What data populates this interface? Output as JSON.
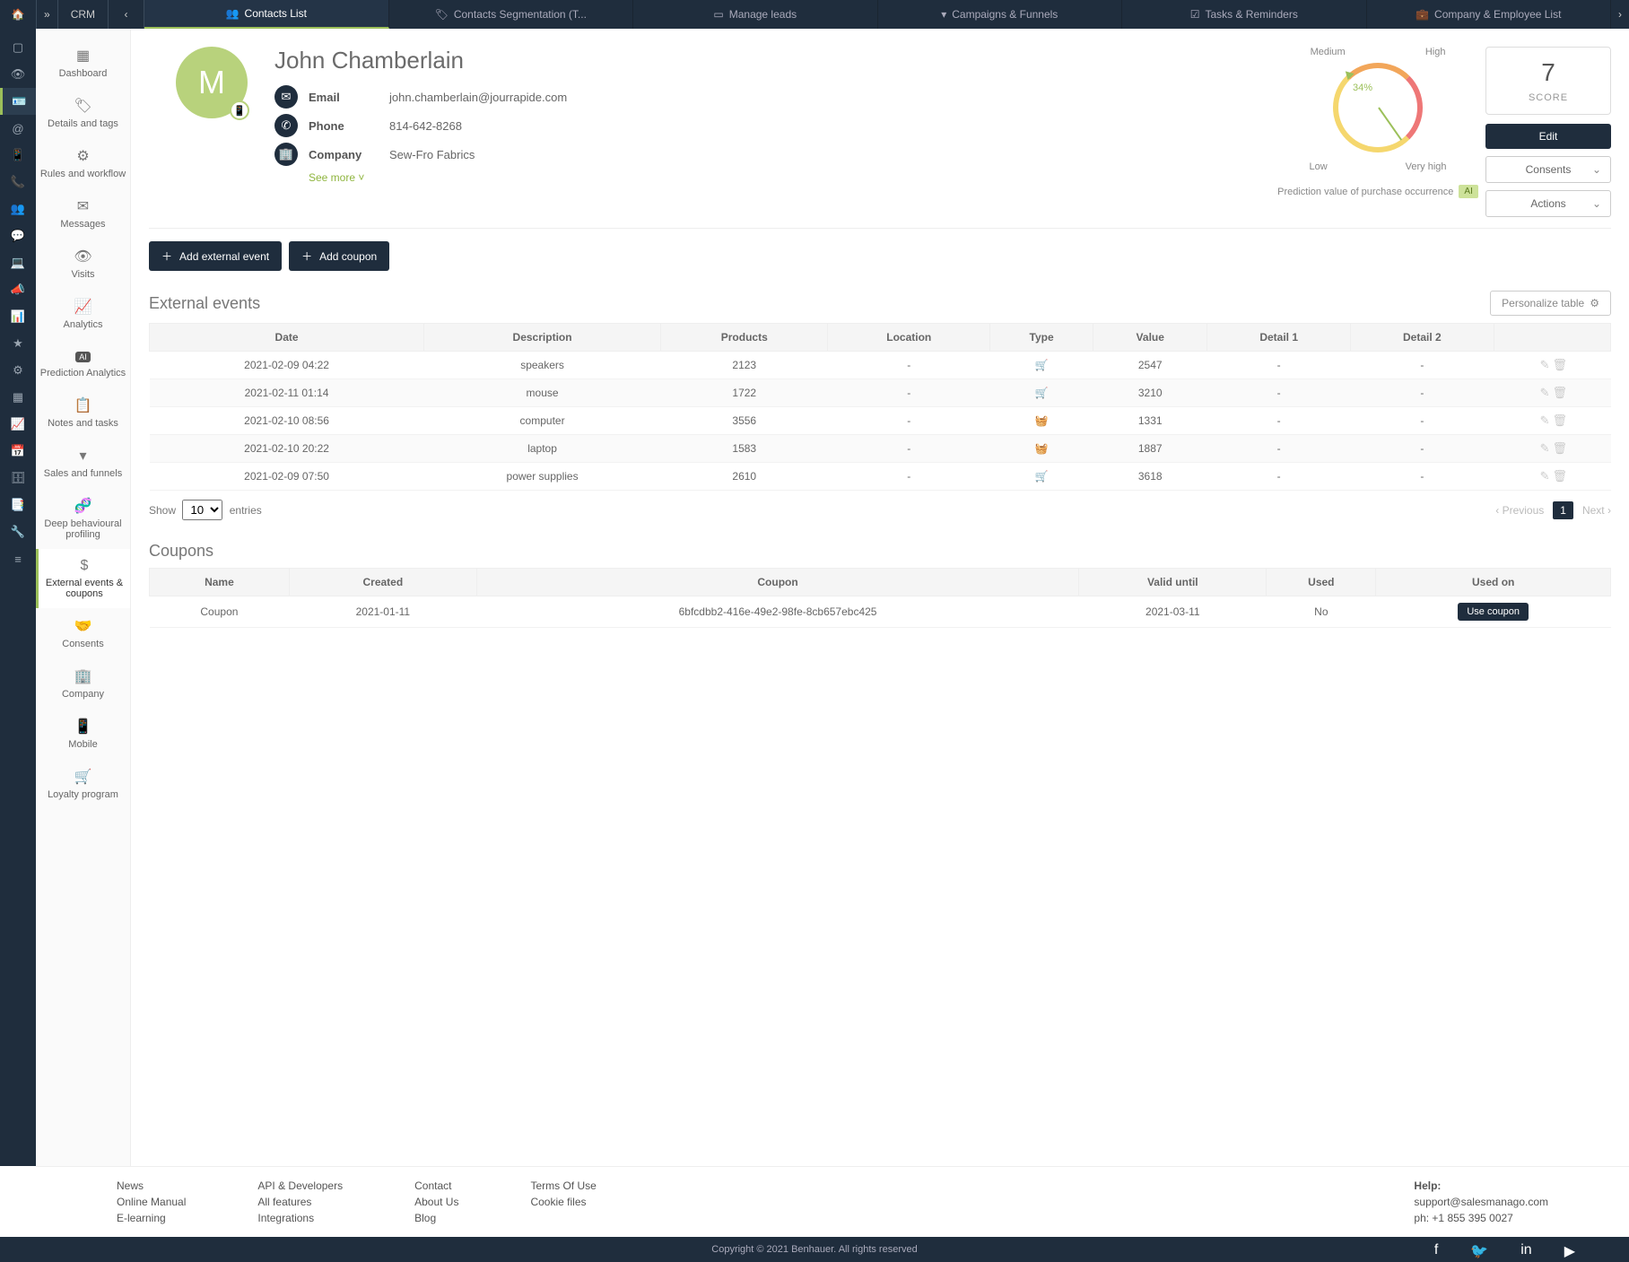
{
  "topbar": {
    "breadcrumb": "CRM",
    "tabs": [
      "Contacts List",
      "Contacts Segmentation (T...",
      "Manage leads",
      "Campaigns & Funnels",
      "Tasks & Reminders",
      "Company & Employee List"
    ]
  },
  "iconrailCount": 20,
  "sidebar": [
    {
      "label": "Dashboard"
    },
    {
      "label": "Details and tags"
    },
    {
      "label": "Rules and workflow"
    },
    {
      "label": "Messages"
    },
    {
      "label": "Visits"
    },
    {
      "label": "Analytics"
    },
    {
      "label": "Prediction Analytics",
      "ai": true
    },
    {
      "label": "Notes and tasks"
    },
    {
      "label": "Sales and funnels"
    },
    {
      "label": "Deep behavioural profiling"
    },
    {
      "label": "External events & coupons",
      "active": true
    },
    {
      "label": "Consents"
    },
    {
      "label": "Company"
    },
    {
      "label": "Mobile"
    },
    {
      "label": "Loyalty program"
    }
  ],
  "contact": {
    "initial": "M",
    "name": "John Chamberlain",
    "email_label": "Email",
    "email": "john.chamberlain@jourrapide.com",
    "phone_label": "Phone",
    "phone": "814-642-8268",
    "company_label": "Company",
    "company": "Sew-Fro Fabrics",
    "see_more": "See more ˅"
  },
  "gauge": {
    "top": [
      "Medium",
      "High"
    ],
    "bottom": [
      "Low",
      "Very high"
    ],
    "pct": "34%",
    "pred_label": "Prediction value of purchase occurrence",
    "ai": "AI"
  },
  "score": {
    "value": "7",
    "label": "SCORE",
    "edit": "Edit",
    "consents": "Consents",
    "actions": "Actions"
  },
  "buttons": {
    "add_event": "Add external event",
    "add_coupon": "Add coupon",
    "personalize": "Personalize table"
  },
  "sections": {
    "events": "External events",
    "coupons": "Coupons"
  },
  "eventsTable": {
    "headers": [
      "Date",
      "Description",
      "Products",
      "Location",
      "Type",
      "Value",
      "Detail 1",
      "Detail 2",
      ""
    ],
    "rows": [
      {
        "date": "2021-02-09 04:22",
        "desc": "speakers",
        "prod": "2123",
        "loc": "-",
        "icon": "cart",
        "value": "2547",
        "d1": "-",
        "d2": "-"
      },
      {
        "date": "2021-02-11 01:14",
        "desc": "mouse",
        "prod": "1722",
        "loc": "-",
        "icon": "cart",
        "value": "3210",
        "d1": "-",
        "d2": "-"
      },
      {
        "date": "2021-02-10 08:56",
        "desc": "computer",
        "prod": "3556",
        "loc": "-",
        "icon": "basket",
        "value": "1331",
        "d1": "-",
        "d2": "-"
      },
      {
        "date": "2021-02-10 20:22",
        "desc": "laptop",
        "prod": "1583",
        "loc": "-",
        "icon": "basket",
        "value": "1887",
        "d1": "-",
        "d2": "-"
      },
      {
        "date": "2021-02-09 07:50",
        "desc": "power supplies",
        "prod": "2610",
        "loc": "-",
        "icon": "cart",
        "value": "3618",
        "d1": "-",
        "d2": "-"
      }
    ]
  },
  "pager": {
    "show": "Show",
    "entries": "entries",
    "per": "10",
    "prev": "Previous",
    "next": "Next",
    "page": "1"
  },
  "couponsTable": {
    "headers": [
      "Name",
      "Created",
      "Coupon",
      "Valid until",
      "Used",
      "Used on"
    ],
    "rows": [
      {
        "name": "Coupon",
        "created": "2021-01-11",
        "code": "6bfcdbb2-416e-49e2-98fe-8cb657ebc425",
        "valid": "2021-03-11",
        "used": "No",
        "btn": "Use coupon"
      }
    ]
  },
  "footer": {
    "cols": [
      [
        "News",
        "Online Manual",
        "E-learning"
      ],
      [
        "API & Developers",
        "All features",
        "Integrations"
      ],
      [
        "Contact",
        "About Us",
        "Blog"
      ],
      [
        "Terms Of Use",
        "Cookie files"
      ]
    ],
    "help_h": "Help:",
    "help_mail": "support@salesmanago.com",
    "help_ph": "ph: +1 855 395 0027",
    "copyright": "Copyright © 2021 Benhauer. All rights reserved"
  }
}
